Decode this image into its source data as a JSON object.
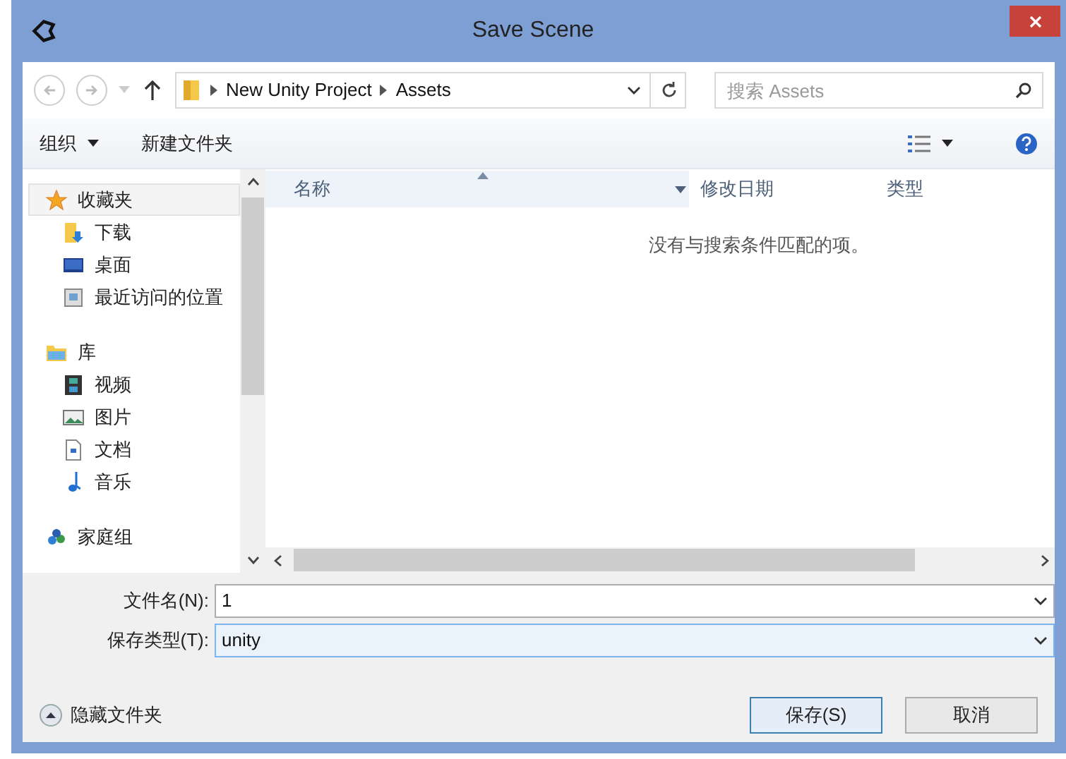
{
  "window": {
    "title": "Save Scene"
  },
  "address": {
    "path": [
      "New Unity Project",
      "Assets"
    ]
  },
  "search": {
    "placeholder": "搜索 Assets"
  },
  "toolbar": {
    "organize": "组织",
    "new_folder": "新建文件夹"
  },
  "sidebar": {
    "groups": [
      {
        "label": "收藏夹",
        "kind": "favorites",
        "selected": true,
        "children": [
          {
            "label": "下载",
            "kind": "downloads",
            "selected": false
          },
          {
            "label": "桌面",
            "kind": "desktop",
            "selected": false
          },
          {
            "label": "最近访问的位置",
            "kind": "recent",
            "selected": false
          }
        ]
      },
      {
        "label": "库",
        "kind": "library",
        "selected": false,
        "children": [
          {
            "label": "视频",
            "kind": "videos",
            "selected": false
          },
          {
            "label": "图片",
            "kind": "pictures",
            "selected": false
          },
          {
            "label": "文档",
            "kind": "documents",
            "selected": false
          },
          {
            "label": "音乐",
            "kind": "music",
            "selected": false
          }
        ]
      },
      {
        "label": "家庭组",
        "kind": "homegroup",
        "selected": false
      }
    ]
  },
  "columns": [
    {
      "label": "名称",
      "sorted": true
    },
    {
      "label": "修改日期",
      "sorted": false
    },
    {
      "label": "类型",
      "sorted": false
    }
  ],
  "empty_message": "没有与搜索条件匹配的项。",
  "fields": [
    {
      "label": "文件名(N):",
      "value": "1",
      "focused": false
    },
    {
      "label": "保存类型(T):",
      "value": "unity",
      "focused": true
    }
  ],
  "hide_folders": "隐藏文件夹",
  "buttons": [
    {
      "label": "保存(S)",
      "default": true
    },
    {
      "label": "取消",
      "default": false
    }
  ]
}
